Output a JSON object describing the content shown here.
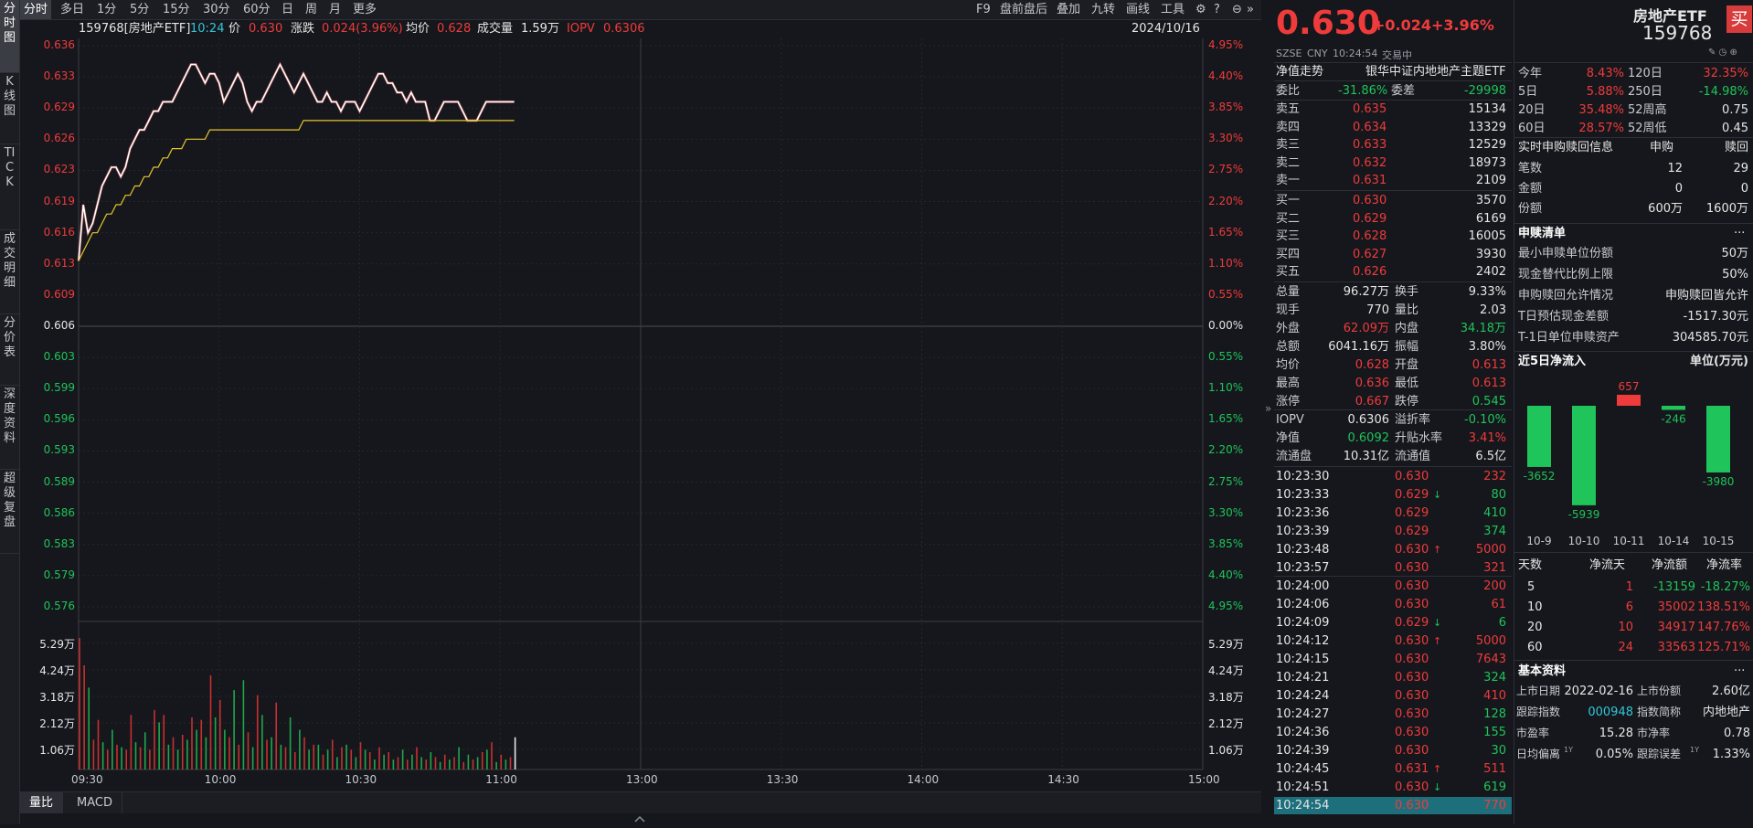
{
  "left_tabs": [
    "分时图",
    "K线图",
    "TICK",
    "成交明细",
    "分价表",
    "深度资料",
    "超级复盘"
  ],
  "toolbar": {
    "left": [
      "分时",
      "多日",
      "1分",
      "5分",
      "15分",
      "30分",
      "60分",
      "日",
      "周",
      "月",
      "更多"
    ],
    "right": [
      "F9",
      "盘前盘后",
      "叠加",
      "九转",
      "画线",
      "工具"
    ]
  },
  "info": {
    "code_name": "159768[房地产ETF]",
    "time": "10:24",
    "price_label": "价",
    "price": "0.630",
    "change_label": "涨跌",
    "change": "0.024(3.96%)",
    "avg_label": "均价",
    "avg": "0.628",
    "volume_label": "成交量",
    "volume": "1.59万",
    "iopv_label": "IOPV",
    "iopv": "0.6306",
    "date": "2024/10/16"
  },
  "chart_data": {
    "type": "line",
    "price_axis_left": [
      "0.636",
      "0.633",
      "0.629",
      "0.626",
      "0.623",
      "0.619",
      "0.616",
      "0.613",
      "0.609",
      "0.606",
      "0.603",
      "0.599",
      "0.596",
      "0.593",
      "0.589",
      "0.586",
      "0.583",
      "0.579",
      "0.576"
    ],
    "price_axis_right": [
      "4.95%",
      "4.40%",
      "3.85%",
      "3.30%",
      "2.75%",
      "2.20%",
      "1.65%",
      "1.10%",
      "0.55%",
      "0.00%",
      "0.55%",
      "1.10%",
      "1.65%",
      "2.20%",
      "2.75%",
      "3.30%",
      "3.85%",
      "4.40%",
      "4.95%"
    ],
    "volume_axis": [
      "5.29万",
      "4.24万",
      "3.18万",
      "2.12万",
      "1.06万"
    ],
    "time_axis": [
      "09:30",
      "10:00",
      "10:30",
      "11:00",
      "13:00",
      "13:30",
      "14:00",
      "14:30",
      "15:00"
    ],
    "ylim": [
      0.576,
      0.636
    ],
    "prev_close": 0.606,
    "series": [
      {
        "name": "价",
        "color": "#ffffff",
        "values": [
          0.613,
          0.619,
          0.616,
          0.617,
          0.619,
          0.621,
          0.622,
          0.623,
          0.623,
          0.622,
          0.623,
          0.625,
          0.626,
          0.627,
          0.627,
          0.628,
          0.629,
          0.629,
          0.63,
          0.63,
          0.63,
          0.631,
          0.632,
          0.633,
          0.634,
          0.634,
          0.633,
          0.632,
          0.633,
          0.633,
          0.632,
          0.63,
          0.631,
          0.632,
          0.633,
          0.632,
          0.63,
          0.629,
          0.63,
          0.63,
          0.631,
          0.632,
          0.633,
          0.634,
          0.633,
          0.632,
          0.631,
          0.632,
          0.633,
          0.632,
          0.631,
          0.63,
          0.63,
          0.631,
          0.63,
          0.63,
          0.629,
          0.63,
          0.63,
          0.63,
          0.629,
          0.63,
          0.631,
          0.632,
          0.633,
          0.633,
          0.632,
          0.632,
          0.631,
          0.631,
          0.63,
          0.631,
          0.63,
          0.63,
          0.63,
          0.628,
          0.628,
          0.629,
          0.63,
          0.63,
          0.63,
          0.63,
          0.629,
          0.628,
          0.628,
          0.628,
          0.629,
          0.63,
          0.63,
          0.63,
          0.63,
          0.63,
          0.63,
          0.63
        ]
      },
      {
        "name": "均价",
        "color": "#e8c52b",
        "values": [
          0.613,
          0.614,
          0.615,
          0.616,
          0.616,
          0.617,
          0.618,
          0.618,
          0.619,
          0.619,
          0.62,
          0.62,
          0.621,
          0.621,
          0.622,
          0.622,
          0.623,
          0.623,
          0.624,
          0.624,
          0.625,
          0.625,
          0.625,
          0.626,
          0.626,
          0.626,
          0.626,
          0.626,
          0.627,
          0.627,
          0.627,
          0.627,
          0.627,
          0.627,
          0.627,
          0.627,
          0.627,
          0.627,
          0.627,
          0.627,
          0.627,
          0.627,
          0.627,
          0.627,
          0.627,
          0.627,
          0.627,
          0.627,
          0.628,
          0.628,
          0.628,
          0.628,
          0.628,
          0.628,
          0.628,
          0.628,
          0.628,
          0.628,
          0.628,
          0.628,
          0.628,
          0.628,
          0.628,
          0.628,
          0.628,
          0.628,
          0.628,
          0.628,
          0.628,
          0.628,
          0.628,
          0.628,
          0.628,
          0.628,
          0.628,
          0.628,
          0.628,
          0.628,
          0.628,
          0.628,
          0.628,
          0.628,
          0.628,
          0.628,
          0.628,
          0.628,
          0.628,
          0.628,
          0.628,
          0.628,
          0.628,
          0.628,
          0.628,
          0.628
        ]
      }
    ],
    "volumes_wan": [
      5.3,
      4.2,
      3.3,
      1.2,
      2.0,
      1.1,
      0.8,
      1.6,
      1.0,
      0.9,
      0.8,
      2.2,
      1.1,
      0.9,
      1.5,
      0.8,
      2.4,
      1.9,
      2.2,
      1.0,
      1.3,
      0.8,
      1.4,
      1.2,
      2.1,
      1.6,
      2.0,
      1.3,
      3.8,
      2.1,
      2.8,
      1.6,
      1.3,
      3.2,
      1.0,
      3.6,
      1.5,
      0.9,
      3.0,
      2.2,
      1.2,
      1.3,
      2.7,
      1.0,
      0.9,
      2.1,
      0.7,
      1.6,
      1.3,
      0.8,
      1.0,
      1.0,
      0.6,
      0.8,
      1.2,
      0.5,
      0.9,
      1.0,
      0.8,
      0.5,
      1.1,
      0.8,
      0.7,
      0.4,
      0.9,
      0.6,
      0.7,
      0.4,
      0.5,
      0.8,
      0.4,
      0.6,
      0.9,
      0.5,
      0.4,
      0.7,
      0.5,
      0.3,
      0.6,
      0.4,
      0.5,
      0.9,
      0.3,
      0.6,
      0.4,
      0.5,
      0.7,
      0.8,
      1.1,
      0.3,
      0.6,
      0.4,
      0.5,
      1.3
    ],
    "volume_colors": [
      "r",
      "r",
      "g",
      "r",
      "r",
      "g",
      "r",
      "g",
      "r",
      "g",
      "r",
      "r",
      "g",
      "r",
      "g",
      "r",
      "r",
      "g",
      "r",
      "g",
      "r",
      "g",
      "r",
      "g",
      "r",
      "g",
      "r",
      "g",
      "r",
      "g",
      "r",
      "g",
      "r",
      "g",
      "r",
      "g",
      "r",
      "g",
      "r",
      "g",
      "r",
      "g",
      "r",
      "g",
      "r",
      "g",
      "r",
      "g",
      "r",
      "g",
      "r",
      "g",
      "r",
      "g",
      "r",
      "g",
      "r",
      "g",
      "r",
      "g",
      "r",
      "g",
      "r",
      "g",
      "r",
      "g",
      "r",
      "g",
      "r",
      "g",
      "r",
      "g",
      "r",
      "g",
      "r",
      "g",
      "r",
      "g",
      "r",
      "g",
      "r",
      "g",
      "r",
      "g",
      "r",
      "g",
      "r",
      "g",
      "r",
      "g",
      "r",
      "g",
      "r",
      "w"
    ],
    "ylabel": "",
    "xlabel": ""
  },
  "bottom_tabs": [
    "量比",
    "MACD"
  ],
  "quote": {
    "price": "0.630",
    "change": "+0.024",
    "pct": "+3.96%",
    "market": "SZSE",
    "currency": "CNY",
    "time": "10:24:54",
    "status": "交易中",
    "name": "房地产ETF",
    "code": "159768",
    "buy_label": "买"
  },
  "nav": {
    "label": "净值走势",
    "fund": "银华中证内地地产主题ETF"
  },
  "weibi": {
    "label1": "委比",
    "v1": "-31.86%",
    "label2": "委差",
    "v2": "-29998"
  },
  "asks": [
    {
      "label": "卖五",
      "price": "0.635",
      "vol": "15134"
    },
    {
      "label": "卖四",
      "price": "0.634",
      "vol": "13329"
    },
    {
      "label": "卖三",
      "price": "0.633",
      "vol": "12529"
    },
    {
      "label": "卖二",
      "price": "0.632",
      "vol": "18973"
    },
    {
      "label": "卖一",
      "price": "0.631",
      "vol": "2109"
    }
  ],
  "bids": [
    {
      "label": "买一",
      "price": "0.630",
      "vol": "3570"
    },
    {
      "label": "买二",
      "price": "0.629",
      "vol": "6169"
    },
    {
      "label": "买三",
      "price": "0.628",
      "vol": "16005"
    },
    {
      "label": "买四",
      "price": "0.627",
      "vol": "3930"
    },
    {
      "label": "买五",
      "price": "0.626",
      "vol": "2402"
    }
  ],
  "stats": [
    {
      "l1": "总量",
      "v1": "96.27万",
      "c1": "white",
      "l2": "换手",
      "v2": "9.33%",
      "c2": "white"
    },
    {
      "l1": "现手",
      "v1": "770",
      "c1": "white",
      "l2": "量比",
      "v2": "2.03",
      "c2": "white"
    },
    {
      "l1": "外盘",
      "v1": "62.09万",
      "c1": "red",
      "l2": "内盘",
      "v2": "34.18万",
      "c2": "green"
    },
    {
      "l1": "总额",
      "v1": "6041.16万",
      "c1": "white",
      "l2": "振幅",
      "v2": "3.80%",
      "c2": "white"
    },
    {
      "l1": "均价",
      "v1": "0.628",
      "c1": "red",
      "l2": "开盘",
      "v2": "0.613",
      "c2": "red"
    },
    {
      "l1": "最高",
      "v1": "0.636",
      "c1": "red",
      "l2": "最低",
      "v2": "0.613",
      "c2": "red"
    },
    {
      "l1": "涨停",
      "v1": "0.667",
      "c1": "red",
      "l2": "跌停",
      "v2": "0.545",
      "c2": "green"
    }
  ],
  "stats2": [
    {
      "l1": "IOPV",
      "v1": "0.6306",
      "c1": "white",
      "l2": "溢折率",
      "v2": "-0.10%",
      "c2": "green"
    },
    {
      "l1": "净值",
      "v1": "0.6092",
      "c1": "green",
      "l2": "升贴水率",
      "v2": "3.41%",
      "c2": "red"
    },
    {
      "l1": "流通盘",
      "v1": "10.31亿",
      "c1": "white",
      "l2": "流通值",
      "v2": "6.5亿",
      "c2": "white"
    }
  ],
  "ticks1": [
    {
      "t": "10:23:30",
      "p": "0.630",
      "a": "",
      "v": "232",
      "vc": "red"
    },
    {
      "t": "10:23:33",
      "p": "0.629",
      "a": "↓",
      "v": "80",
      "vc": "green"
    },
    {
      "t": "10:23:36",
      "p": "0.629",
      "a": "",
      "v": "410",
      "vc": "green"
    },
    {
      "t": "10:23:39",
      "p": "0.629",
      "a": "",
      "v": "374",
      "vc": "green"
    },
    {
      "t": "10:23:48",
      "p": "0.630",
      "a": "↑",
      "v": "5000",
      "vc": "red"
    },
    {
      "t": "10:23:57",
      "p": "0.630",
      "a": "",
      "v": "321",
      "vc": "red"
    }
  ],
  "ticks2": [
    {
      "t": "10:24:00",
      "p": "0.630",
      "a": "",
      "v": "200",
      "vc": "red"
    },
    {
      "t": "10:24:06",
      "p": "0.630",
      "a": "",
      "v": "61",
      "vc": "red"
    },
    {
      "t": "10:24:09",
      "p": "0.629",
      "a": "↓",
      "v": "6",
      "vc": "green"
    },
    {
      "t": "10:24:12",
      "p": "0.630",
      "a": "↑",
      "v": "5000",
      "vc": "red"
    },
    {
      "t": "10:24:15",
      "p": "0.630",
      "a": "",
      "v": "7643",
      "vc": "red"
    },
    {
      "t": "10:24:21",
      "p": "0.630",
      "a": "",
      "v": "324",
      "vc": "green"
    },
    {
      "t": "10:24:24",
      "p": "0.630",
      "a": "",
      "v": "410",
      "vc": "red"
    },
    {
      "t": "10:24:27",
      "p": "0.630",
      "a": "",
      "v": "128",
      "vc": "green"
    },
    {
      "t": "10:24:36",
      "p": "0.630",
      "a": "",
      "v": "155",
      "vc": "green"
    },
    {
      "t": "10:24:39",
      "p": "0.630",
      "a": "",
      "v": "30",
      "vc": "green"
    },
    {
      "t": "10:24:45",
      "p": "0.631",
      "a": "↑",
      "v": "511",
      "vc": "red"
    },
    {
      "t": "10:24:51",
      "p": "0.630",
      "a": "↓",
      "v": "619",
      "vc": "green"
    },
    {
      "t": "10:24:54",
      "p": "0.630",
      "a": "",
      "v": "770",
      "vc": "red"
    }
  ],
  "perf": [
    {
      "l1": "今年",
      "v1": "8.43%",
      "l2": "120日",
      "v2": "32.35%",
      "c2": "red"
    },
    {
      "l1": "5日",
      "v1": "5.88%",
      "l2": "250日",
      "v2": "-14.98%",
      "c2": "green"
    },
    {
      "l1": "20日",
      "v1": "35.48%",
      "l2": "52周高",
      "v2": "0.75",
      "c2": "white"
    },
    {
      "l1": "60日",
      "v1": "28.57%",
      "l2": "52周低",
      "v2": "0.45",
      "c2": "white"
    }
  ],
  "subscription": {
    "title": "实时申购赎回信息",
    "col1": "申购",
    "col2": "赎回",
    "rows": [
      {
        "l": "笔数",
        "a": "12",
        "b": "29"
      },
      {
        "l": "金额",
        "a": "0",
        "b": "0"
      },
      {
        "l": "份额",
        "a": "600万",
        "b": "1600万"
      }
    ]
  },
  "creation_list": {
    "title": "申赎清单",
    "more": "···",
    "rows": [
      {
        "l": "最小申赎单位份额",
        "v": "50万"
      },
      {
        "l": "现金替代比例上限",
        "v": "50%"
      },
      {
        "l": "申购赎回允许情况",
        "v": "申购赎回皆允许"
      },
      {
        "l": "T日预估现金差额",
        "v": "-1517.30元"
      },
      {
        "l": "T-1日单位申赎资产",
        "v": "304585.70元"
      }
    ]
  },
  "netflow": {
    "title": "近5日净流入",
    "unit": "单位(万元)",
    "days": [
      "10-9",
      "10-10",
      "10-11",
      "10-14",
      "10-15"
    ],
    "values": [
      -3652,
      -5939,
      657,
      -246,
      -3980
    ],
    "labels": [
      "-3652",
      "-5939",
      "657",
      "-246",
      "-3980"
    ]
  },
  "flowtable": {
    "headers": [
      "天数",
      "净流天",
      "净流额",
      "净流率"
    ],
    "rows": [
      {
        "d": "5",
        "n": "1",
        "a": "-13159",
        "r": "-18.27%",
        "ca": "green",
        "cr": "green"
      },
      {
        "d": "10",
        "n": "6",
        "a": "35002",
        "r": "138.51%",
        "ca": "red",
        "cr": "red"
      },
      {
        "d": "20",
        "n": "10",
        "a": "34917",
        "r": "147.76%",
        "ca": "red",
        "cr": "red"
      },
      {
        "d": "60",
        "n": "24",
        "a": "33563",
        "r": "125.71%",
        "ca": "red",
        "cr": "red"
      }
    ]
  },
  "basics": {
    "title": "基本资料",
    "more": "···",
    "rows": [
      {
        "l1": "上市日期",
        "v1": "2022-02-16",
        "l2": "上市份额",
        "v2": "2.60亿"
      },
      {
        "l1": "跟踪指数",
        "v1": "000948",
        "l2": "指数简称",
        "v2": "内地地产"
      },
      {
        "l1": "市盈率",
        "v1": "15.28",
        "l2": "市净率",
        "v2": "0.78"
      },
      {
        "l1": "日均偏离",
        "s1": "1Y",
        "v1": "0.05%",
        "l2": "跟踪误差",
        "s2": "1Y",
        "v2": "1.33%"
      }
    ]
  }
}
